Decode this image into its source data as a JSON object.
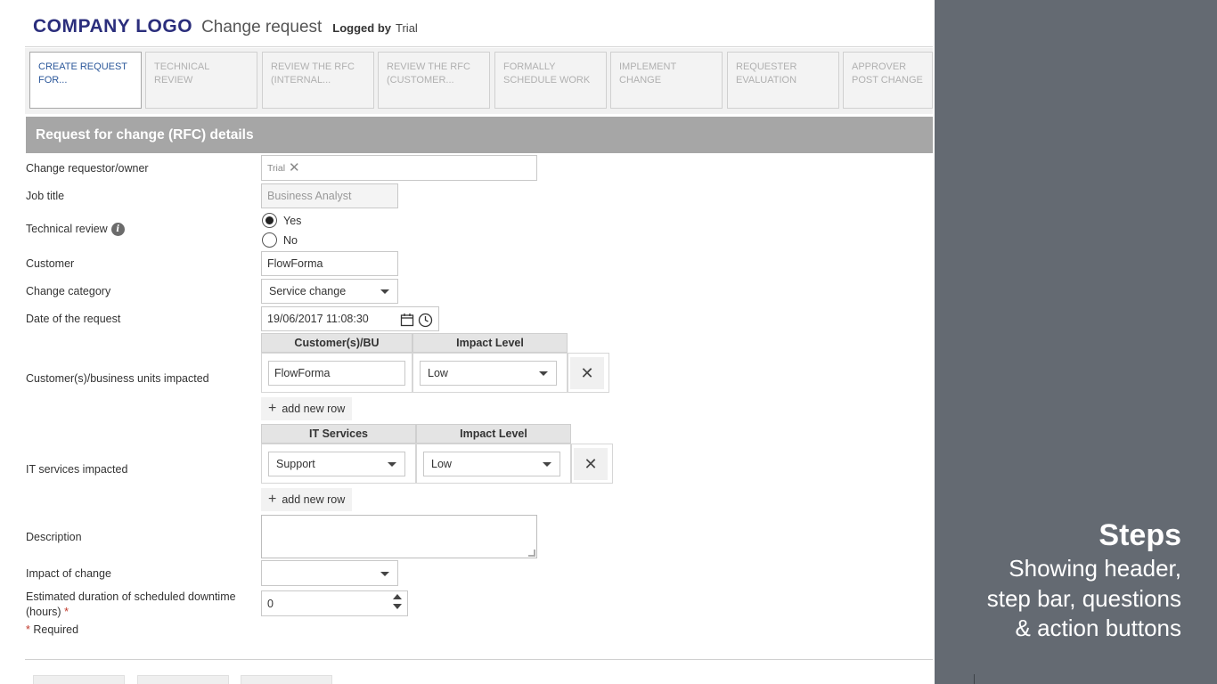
{
  "header": {
    "logo": "COMPANY LOGO",
    "form_title": "Change request",
    "logged_by_label": "Logged by",
    "logged_by_user": "Trial"
  },
  "steps": [
    {
      "label": "CREATE REQUEST FOR...",
      "active": true
    },
    {
      "label": "TECHNICAL REVIEW",
      "active": false
    },
    {
      "label": "REVIEW THE RFC (INTERNAL...",
      "active": false
    },
    {
      "label": "REVIEW THE RFC (CUSTOMER...",
      "active": false
    },
    {
      "label": "FORMALLY SCHEDULE WORK",
      "active": false
    },
    {
      "label": "IMPLEMENT CHANGE",
      "active": false
    },
    {
      "label": "REQUESTER EVALUATION",
      "active": false
    },
    {
      "label": "APPROVER POST CHANGE",
      "active": false
    }
  ],
  "section": {
    "title": "Request for change (RFC) details"
  },
  "form": {
    "requestor": {
      "label": "Change requestor/owner",
      "value": "Trial"
    },
    "job_title": {
      "label": "Job title",
      "value": "Business Analyst"
    },
    "technical_review": {
      "label": "Technical review",
      "options": [
        "Yes",
        "No"
      ],
      "selected": "Yes"
    },
    "customer": {
      "label": "Customer",
      "value": "FlowForma"
    },
    "change_category": {
      "label": "Change category",
      "value": "Service change"
    },
    "date_of_request": {
      "label": "Date of the request",
      "value": "19/06/2017 11:08:30"
    },
    "customers_impacted": {
      "label": "Customer(s)/business units impacted",
      "columns": [
        "Customer(s)/BU",
        "Impact Level"
      ],
      "rows": [
        {
          "customer": "FlowForma",
          "impact": "Low"
        }
      ],
      "add_row_label": "add new row"
    },
    "it_services_impacted": {
      "label": "IT services impacted",
      "columns": [
        "IT Services",
        "Impact Level"
      ],
      "rows": [
        {
          "service": "Support",
          "impact": "Low"
        }
      ],
      "add_row_label": "add new row"
    },
    "description": {
      "label": "Description",
      "value": ""
    },
    "impact_of_change": {
      "label": "Impact of change",
      "value": ""
    },
    "downtime": {
      "label_line1": "Estimated duration of scheduled downtime",
      "label_line2": "(hours)",
      "required_mark": "*",
      "value": "0"
    },
    "required_note": {
      "mark": "*",
      "text": "Required"
    }
  },
  "side_panel": {
    "title": "Steps",
    "lines": [
      "Showing header,",
      "step bar, questions",
      "& action buttons"
    ]
  },
  "colors": {
    "logo": "#2b2e7c",
    "active_step_text": "#2b579a",
    "section_header_bg": "#a6a6a6",
    "side_panel_bg": "#646a72",
    "required": "#c0392b"
  },
  "icons": [
    "info-icon",
    "calendar-icon",
    "clock-icon",
    "close-icon",
    "plus-icon",
    "chevron-down-icon"
  ]
}
